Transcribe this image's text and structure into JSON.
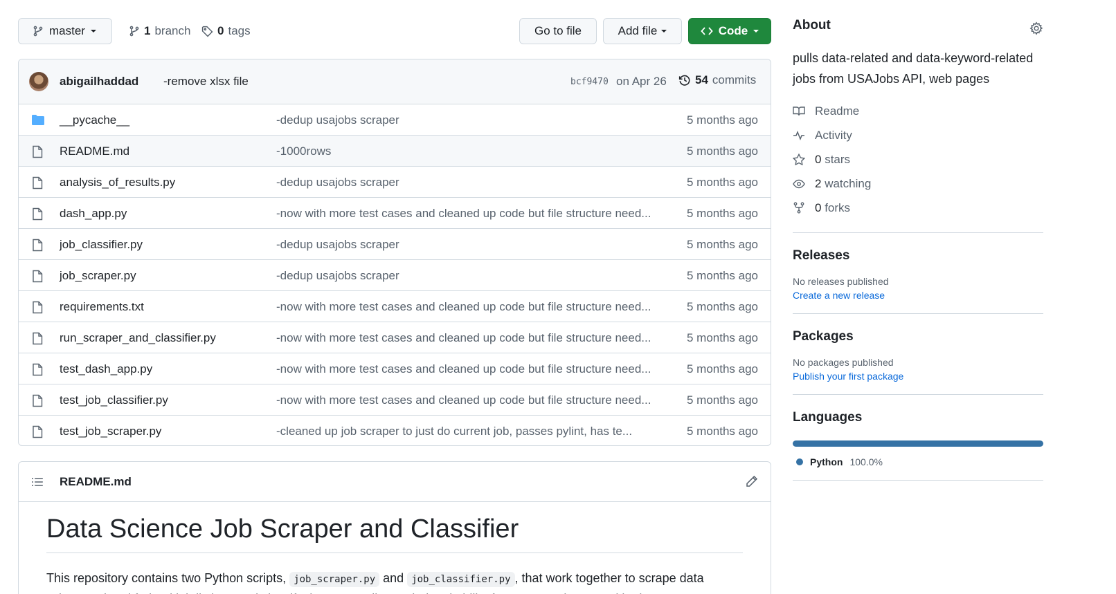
{
  "toolbar": {
    "branch": "master",
    "branch_count": "1",
    "branch_label": "branch",
    "tag_count": "0",
    "tag_label": "tags",
    "goto_file": "Go to file",
    "add_file": "Add file",
    "code": "Code"
  },
  "commit": {
    "author": "abigailhaddad",
    "message": "-remove xlsx file",
    "hash": "bcf9470",
    "date": "on Apr 26",
    "count": "54",
    "count_label": "commits"
  },
  "files": [
    {
      "name": "__pycache__",
      "type": "folder",
      "message": "-dedup usajobs scraper",
      "age": "5 months ago"
    },
    {
      "name": "README.md",
      "type": "file",
      "message": "-1000rows",
      "age": "5 months ago"
    },
    {
      "name": "analysis_of_results.py",
      "type": "file",
      "message": "-dedup usajobs scraper",
      "age": "5 months ago"
    },
    {
      "name": "dash_app.py",
      "type": "file",
      "message": "-now with more test cases and cleaned up code but file structure need...",
      "age": "5 months ago"
    },
    {
      "name": "job_classifier.py",
      "type": "file",
      "message": "-dedup usajobs scraper",
      "age": "5 months ago"
    },
    {
      "name": "job_scraper.py",
      "type": "file",
      "message": "-dedup usajobs scraper",
      "age": "5 months ago"
    },
    {
      "name": "requirements.txt",
      "type": "file",
      "message": "-now with more test cases and cleaned up code but file structure need...",
      "age": "5 months ago"
    },
    {
      "name": "run_scraper_and_classifier.py",
      "type": "file",
      "message": "-now with more test cases and cleaned up code but file structure need...",
      "age": "5 months ago"
    },
    {
      "name": "test_dash_app.py",
      "type": "file",
      "message": "-now with more test cases and cleaned up code but file structure need...",
      "age": "5 months ago"
    },
    {
      "name": "test_job_classifier.py",
      "type": "file",
      "message": "-now with more test cases and cleaned up code but file structure need...",
      "age": "5 months ago"
    },
    {
      "name": "test_job_scraper.py",
      "type": "file",
      "message": "-cleaned up job scraper to just do current job, passes pylint, has te...",
      "age": "5 months ago"
    }
  ],
  "readme": {
    "filename": "README.md",
    "title": "Data Science Job Scraper and Classifier",
    "para_start": "This repository contains two Python scripts, ",
    "code1": "job_scraper.py",
    "para_and": " and ",
    "code2": "job_classifier.py",
    "para_end": ", that work together to scrape data science-related federal job listings and classify them according to their suitability for someone interested in data"
  },
  "about": {
    "heading": "About",
    "description": "pulls data-related and data-keyword-related jobs from USAJobs API, web pages",
    "readme": "Readme",
    "activity": "Activity",
    "stars_count": "0",
    "stars_label": "stars",
    "watching_count": "2",
    "watching_label": "watching",
    "forks_count": "0",
    "forks_label": "forks"
  },
  "releases": {
    "heading": "Releases",
    "empty": "No releases published",
    "link": "Create a new release"
  },
  "packages": {
    "heading": "Packages",
    "empty": "No packages published",
    "link": "Publish your first package"
  },
  "languages": {
    "heading": "Languages",
    "name": "Python",
    "percent": "100.0%",
    "percent_value": 100,
    "color": "#3572a5"
  },
  "colors": {
    "accent_green": "#1f883d",
    "link_blue": "#0969da",
    "folder_blue": "#54aeff"
  }
}
